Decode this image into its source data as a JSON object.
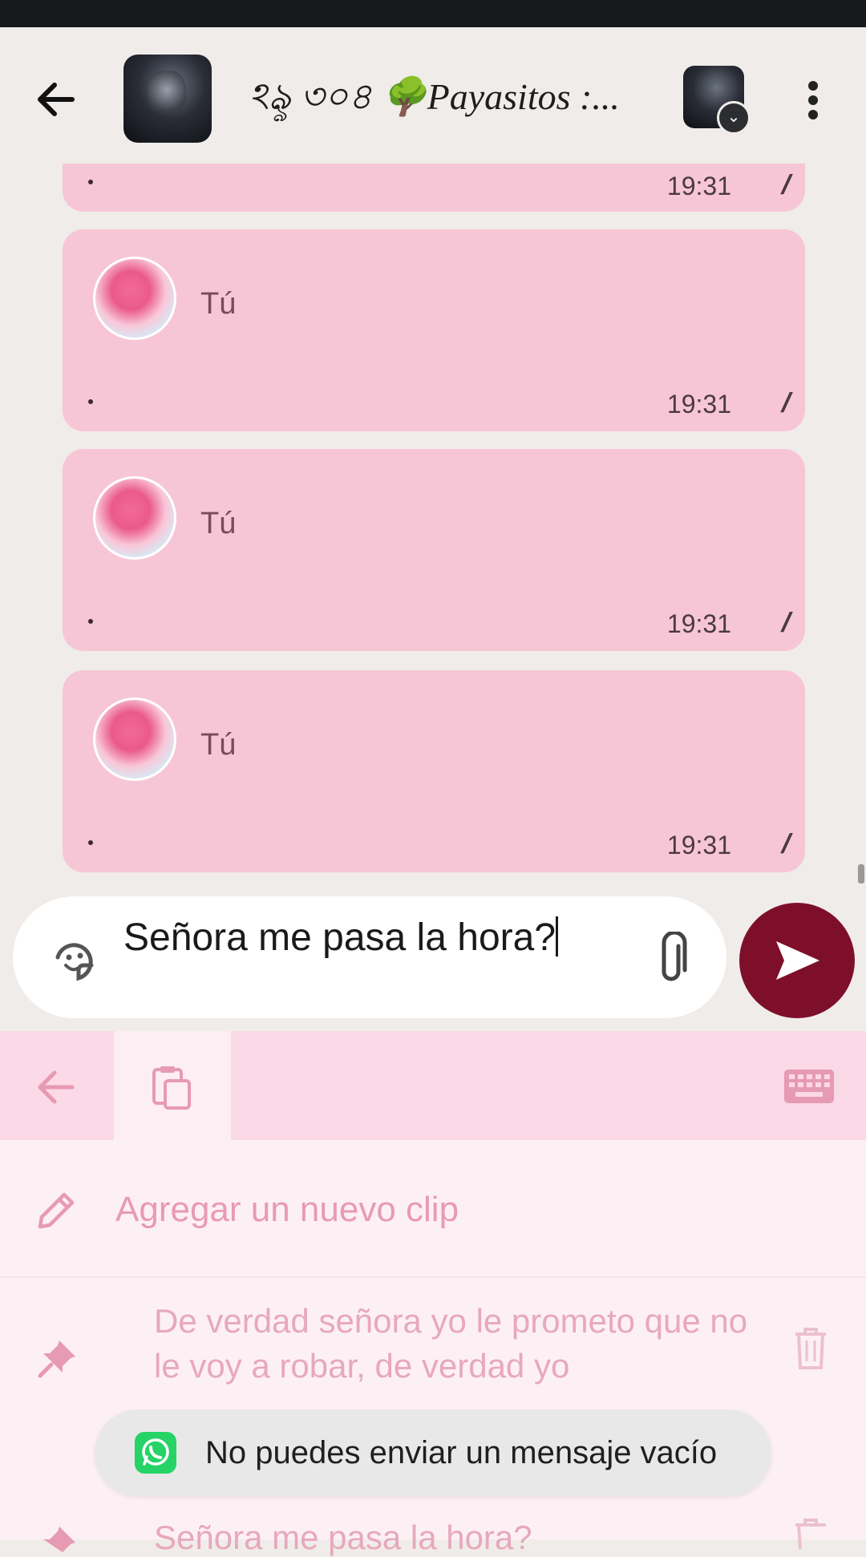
{
  "header": {
    "title": "ঽৡ ৩০৪ 🌳Payasitos :...",
    "back_icon": "arrow-left-icon",
    "menu_icon": "more-vert-icon"
  },
  "messages": [
    {
      "sender": "",
      "time": "19:31",
      "ticks": "//",
      "dot": "."
    },
    {
      "sender": "Tú",
      "time": "19:31",
      "ticks": "//",
      "dot": "."
    },
    {
      "sender": "Tú",
      "time": "19:31",
      "ticks": "//",
      "dot": "."
    },
    {
      "sender": "Tú",
      "time": "19:31",
      "ticks": "//",
      "dot": "."
    }
  ],
  "composer": {
    "value": "Señora me pasa la hora?"
  },
  "keyboard": {
    "add_clip_label": "Agregar un nuevo clip",
    "clips": [
      {
        "text": "De verdad señora  yo le prometo que no le voy a robar, de verdad yo"
      },
      {
        "text": "Señora me pasa la hora?"
      }
    ]
  },
  "toast": {
    "message": "No puedes enviar un mensaje vacío"
  },
  "colors": {
    "bubble": "#f7c6d6",
    "send_button": "#7e0f2b",
    "keyboard_bar": "#fbd9e6",
    "clip_text": "#e7a8bd"
  }
}
